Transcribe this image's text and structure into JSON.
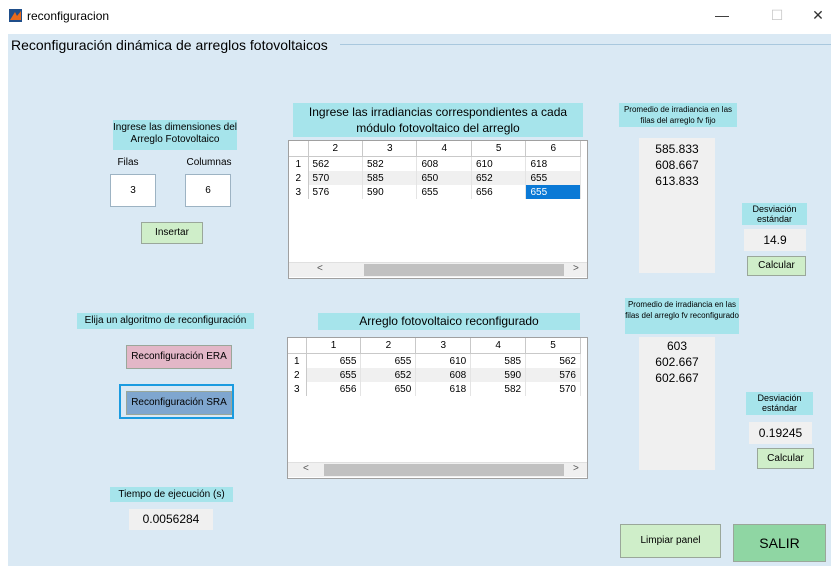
{
  "window": {
    "title": "reconfiguracion",
    "minimize": "—",
    "maximize": "☐",
    "close": "✕"
  },
  "panel_title": "Reconfiguración dinámica de arreglos fotovoltaicos",
  "dims": {
    "heading": "Ingrese las dimensiones del Arreglo Fotovoltaico",
    "rows_label": "Filas",
    "cols_label": "Columnas",
    "rows_value": "3",
    "cols_value": "6",
    "insert_label": "Insertar"
  },
  "irr_table": {
    "heading": "Ingrese las irradiancias correspondientes a cada módulo fotovoltaico del arreglo",
    "columns": [
      "2",
      "3",
      "4",
      "5",
      "6"
    ],
    "row_numbers": [
      "1",
      "2",
      "3"
    ],
    "rows": [
      [
        "562",
        "582",
        "608",
        "610",
        "618"
      ],
      [
        "570",
        "585",
        "650",
        "652",
        "655"
      ],
      [
        "576",
        "590",
        "655",
        "656",
        "655"
      ]
    ]
  },
  "fixed_avg": {
    "heading": "Promedio de irradiancia en las filas del arreglo fv fijo",
    "values": [
      "585.833",
      "608.667",
      "613.833"
    ]
  },
  "std1": {
    "heading": "Desviación estándar",
    "value": "14.9",
    "calc_label": "Calcular"
  },
  "algo": {
    "heading": "Elija un algoritmo de reconfiguración",
    "era_label": "Reconfiguración ERA",
    "sra_label": "Reconfiguración SRA"
  },
  "reconf_table": {
    "heading": "Arreglo fotovoltaico reconfigurado",
    "columns": [
      "1",
      "2",
      "3",
      "4",
      "5"
    ],
    "row_numbers": [
      "1",
      "2",
      "3"
    ],
    "rows": [
      [
        "655",
        "655",
        "610",
        "585",
        "562"
      ],
      [
        "655",
        "652",
        "608",
        "590",
        "576"
      ],
      [
        "656",
        "650",
        "618",
        "582",
        "570"
      ]
    ]
  },
  "reconf_avg": {
    "heading": "Promedio de irradiancia en las filas del arreglo fv reconfigurado",
    "values": [
      "603",
      "602.667",
      "602.667"
    ]
  },
  "std2": {
    "heading": "Desviación estándar",
    "value": "0.19245",
    "calc_label": "Calcular"
  },
  "exec_time": {
    "heading": "Tiempo de ejecución (s)",
    "value": "0.0056284"
  },
  "clear_label": "Limpiar panel",
  "exit_label": "SALIR",
  "colors": {
    "panel": "#dae9f4",
    "label_bg": "#a6e4eb",
    "era": "#e3b7c7",
    "sra": "#7fa6cf",
    "green_btn": "#cfeec9",
    "selection": "#0a79d6"
  }
}
